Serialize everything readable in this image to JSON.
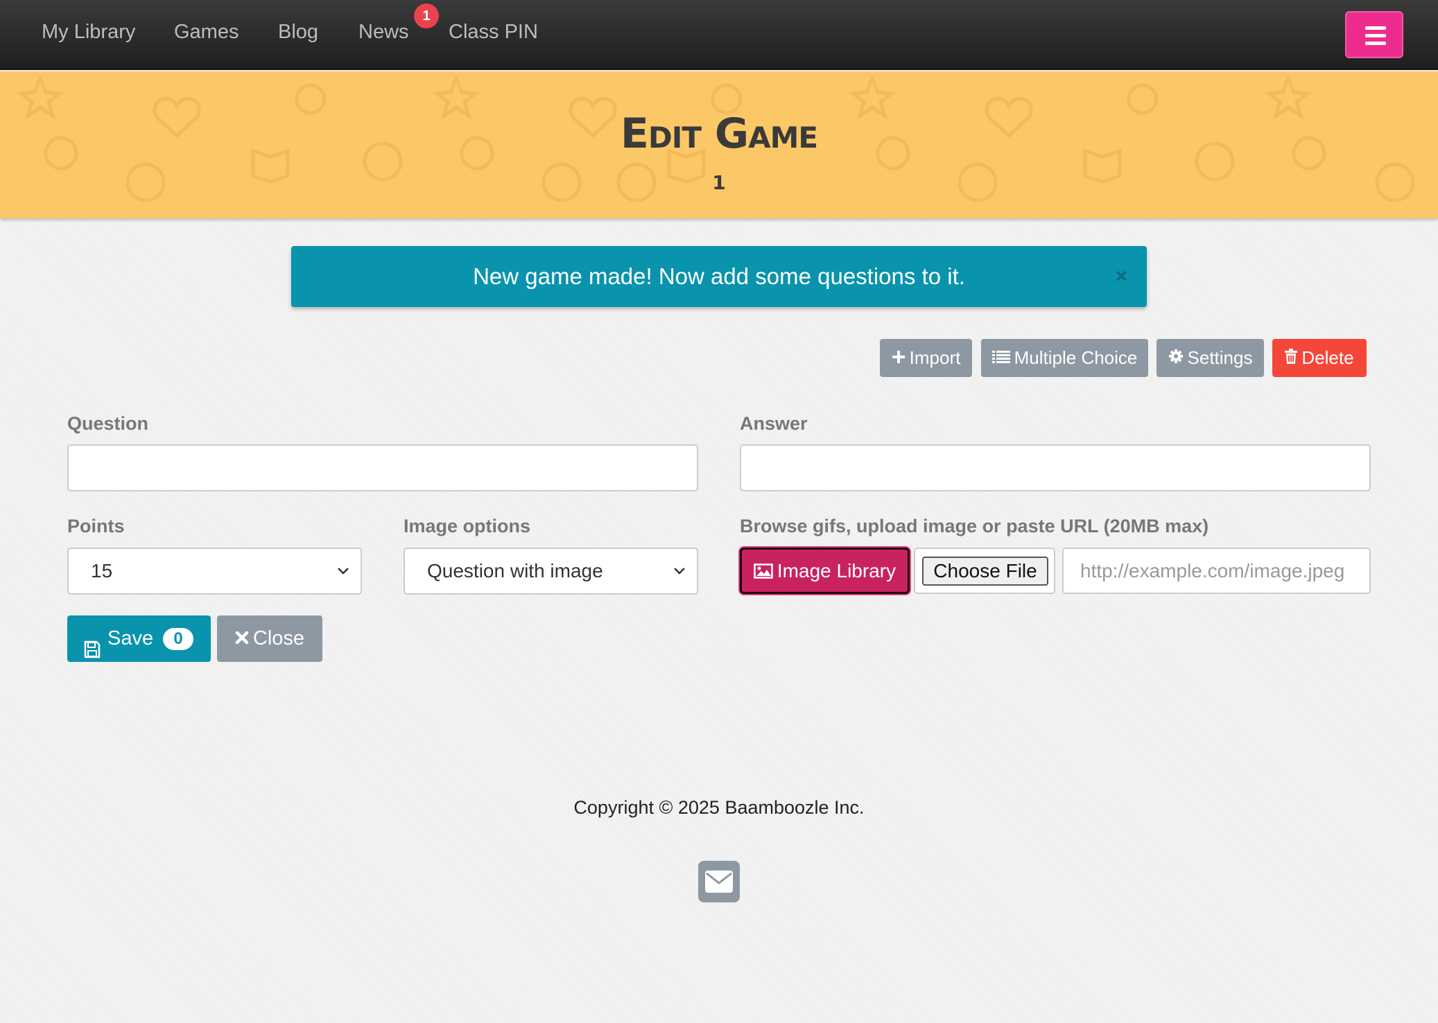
{
  "nav": {
    "items": [
      "My Library",
      "Games",
      "Blog",
      "News",
      "Class PIN"
    ],
    "news_badge": "1"
  },
  "banner": {
    "title": "Edit Game",
    "subtitle": "1"
  },
  "alert": {
    "message": "New game made! Now add some questions to it.",
    "close": "×"
  },
  "actions": {
    "import": "Import",
    "multiple_choice": "Multiple Choice",
    "settings": "Settings",
    "delete": "Delete"
  },
  "form": {
    "question_label": "Question",
    "question_value": "",
    "answer_label": "Answer",
    "answer_value": "",
    "points_label": "Points",
    "points_value": "15",
    "image_options_label": "Image options",
    "image_options_value": "Question with image",
    "image_source_label": "Browse gifs, upload image or paste URL (20MB max)",
    "image_library_button": "Image Library",
    "choose_file_button": "Choose File",
    "url_placeholder": "http://example.com/image.jpeg",
    "save_button": "Save",
    "save_count": "0",
    "close_button": "Close"
  },
  "footer": {
    "copyright": "Copyright © 2025 Baamboozle Inc."
  },
  "colors": {
    "navbar": "#2b2b2b",
    "menu_button": "#ec2d8d",
    "banner": "#fcc766",
    "alert": "#0a93ad",
    "grey_button": "#8e98a3",
    "delete_button": "#f4473a",
    "image_library_button": "#c8235f"
  },
  "icons": [
    "hamburger-icon",
    "plus-icon",
    "list-icon",
    "gear-icon",
    "trash-icon",
    "image-icon",
    "save-icon",
    "close-icon",
    "mail-icon"
  ]
}
